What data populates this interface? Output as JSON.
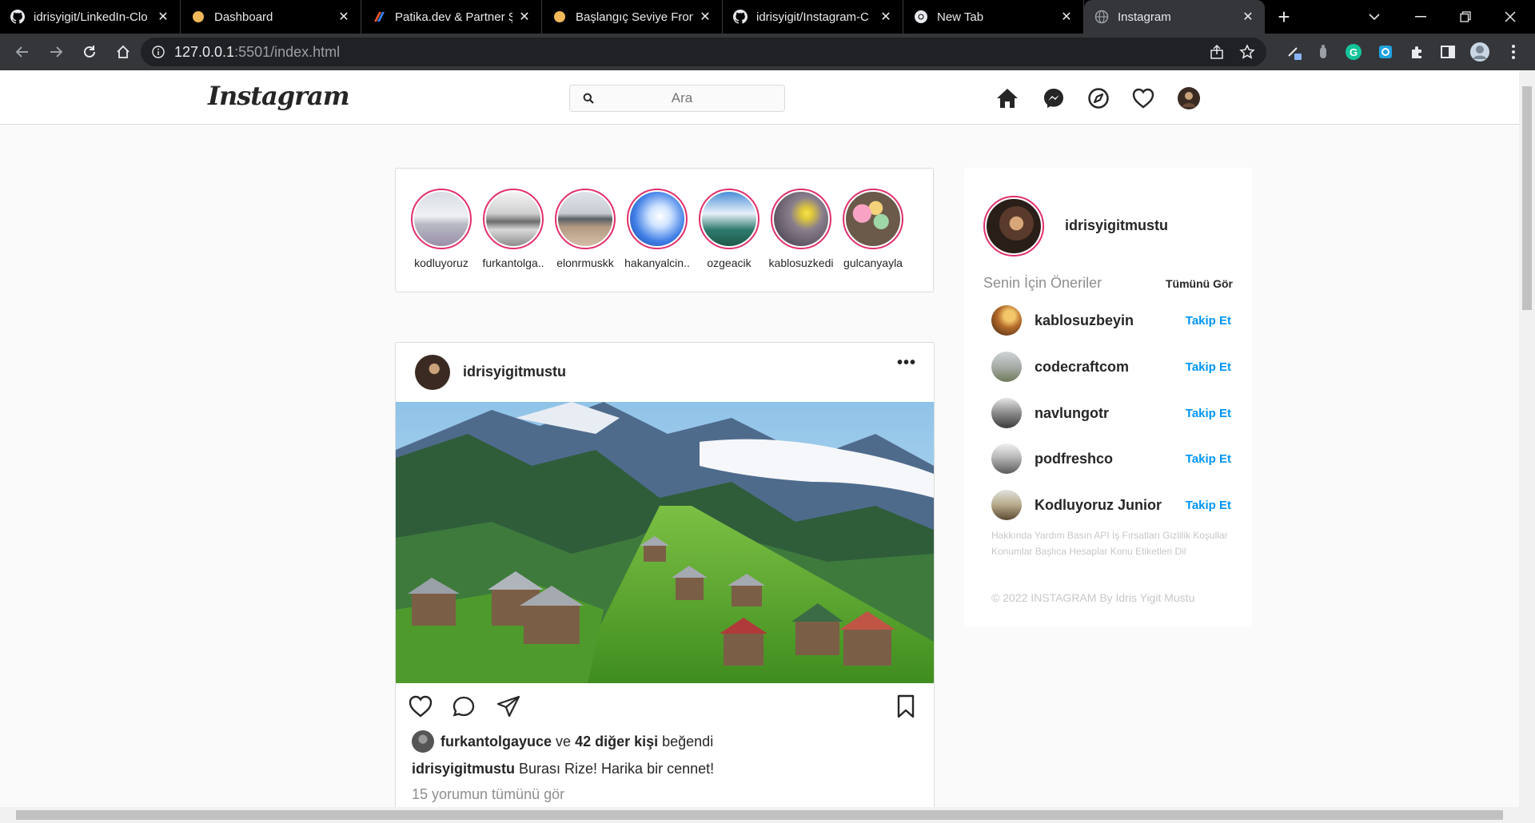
{
  "browser": {
    "tabs": [
      {
        "title": "idrisyigit/LinkedIn-Clo",
        "icon": "github-icon"
      },
      {
        "title": "Dashboard",
        "icon": "circle-icon"
      },
      {
        "title": "Patika.dev & Partner Şi",
        "icon": "patika-icon"
      },
      {
        "title": "Başlangıç Seviye Front",
        "icon": "circle-icon"
      },
      {
        "title": "idrisyigit/Instagram-C",
        "icon": "github-icon"
      },
      {
        "title": "New Tab",
        "icon": "chrome-icon"
      },
      {
        "title": "Instagram",
        "icon": "globe-icon"
      }
    ],
    "active_tab": 6,
    "url_host": "127.0.0.1",
    "url_path": ":5501/index.html"
  },
  "header": {
    "logo": "Instagram",
    "search_placeholder": "Ara"
  },
  "stories": [
    {
      "name": "kodluyoruz"
    },
    {
      "name": "furkantolga.."
    },
    {
      "name": "elonrmuskk"
    },
    {
      "name": "hakanyalcin.."
    },
    {
      "name": "ozgeacik"
    },
    {
      "name": "kablosuzkedi"
    },
    {
      "name": "gulcanyayla"
    }
  ],
  "post": {
    "username": "idrisyigitmustu",
    "more": "•••",
    "liked_by": "furkantolgayuce",
    "liked_mid": " ve ",
    "liked_others": "42 diğer kişi",
    "liked_suffix": " beğendi",
    "caption_user": "idrisyigitmustu",
    "caption_text": " Burası Rize! Harika bir cennet!",
    "comments_link": "15 yorumun tümünü gör"
  },
  "sidebar": {
    "username": "idrisyigitmustu",
    "suggestions_title": "Senin İçin Öneriler",
    "see_all": "Tümünü Gör",
    "suggestions": [
      {
        "name": "kablosuzbeyin",
        "follow": "Takip Et"
      },
      {
        "name": "codecraftcom",
        "follow": "Takip Et"
      },
      {
        "name": "navlungotr",
        "follow": "Takip Et"
      },
      {
        "name": "podfreshco",
        "follow": "Takip Et"
      },
      {
        "name": "Kodluyoruz Junior",
        "follow": "Takip Et"
      }
    ],
    "footer_links": "Hakkında Yardım Basın API İş Fırsatları Gizlilik Koşullar Konumlar Başlıca Hesaplar Konu Etiketleri Dil",
    "copyright": "© 2022 INSTAGRAM By Idris Yigit Mustu"
  },
  "colors": {
    "accent": "#0095f6",
    "story_ring": "#e1306c",
    "text": "#262626",
    "muted": "#8e8e8e"
  }
}
